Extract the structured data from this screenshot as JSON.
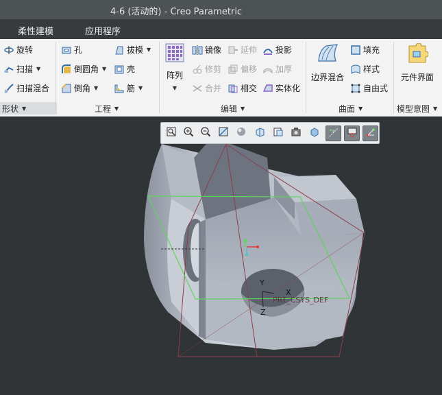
{
  "window": {
    "title": "4-6 (活动的) - Creo Parametric"
  },
  "tabs": [
    {
      "label": "柔性建模"
    },
    {
      "label": "应用程序"
    }
  ],
  "ribbon": {
    "shape": {
      "revolve": "旋转",
      "sweep": "扫描",
      "swept_blend": "扫描混合",
      "group_label": "形状"
    },
    "engineering": {
      "hole": "孔",
      "draft": "拔模",
      "round": "倒圆角",
      "shell": "壳",
      "chamfer": "倒角",
      "rib": "筋",
      "group_label": "工程"
    },
    "editing": {
      "pattern": "阵列",
      "mirror": "镜像",
      "extend": "延伸",
      "project": "投影",
      "trim": "修剪",
      "offset": "偏移",
      "thicken": "加厚",
      "merge": "合并",
      "intersect": "相交",
      "solidify": "实体化",
      "group_label": "编辑"
    },
    "surfaces": {
      "boundary_blend": "边界混合",
      "fill": "填充",
      "style": "样式",
      "freestyle": "自由式",
      "group_label": "曲面"
    },
    "model_intent": {
      "component_interface": "元件界面",
      "group_label": "模型意图"
    }
  },
  "view_toolbar": {
    "buttons": [
      "refit-icon",
      "zoom-in-icon",
      "zoom-out-icon",
      "repaint-icon",
      "display-style-icon",
      "saved-orientations-icon",
      "view-manager-icon",
      "perspective-icon",
      "spin-center-icon",
      "datum-display-icon",
      "annotation-display-icon",
      "csys-display-icon"
    ]
  },
  "model_labels": {
    "axis_y": "Y",
    "axis_x": "X",
    "axis_z": "Z",
    "csys_name": "PRT_CSYS_DEF"
  },
  "colors": {
    "accent_green": "#5fd35f",
    "model_body": "#a3aab8",
    "datum_plane": "#8a3f4a"
  }
}
